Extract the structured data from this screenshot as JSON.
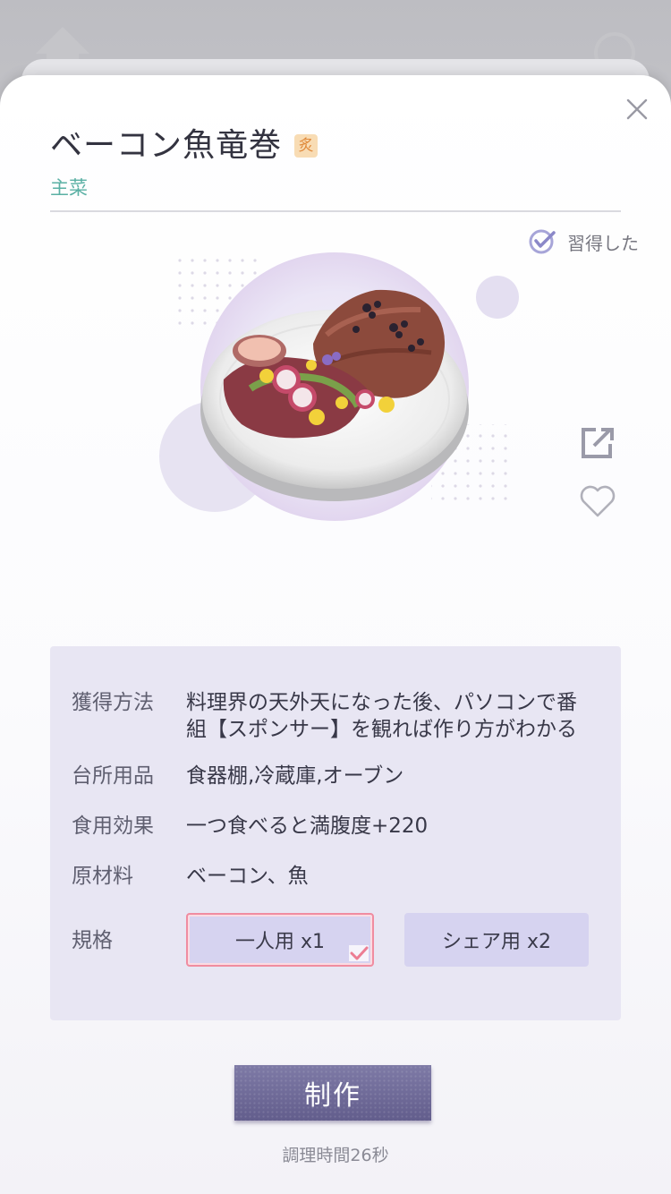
{
  "dish": {
    "name": "ベーコン魚竜巻",
    "badge": "炙",
    "category": "主菜",
    "learned_label": "習得した"
  },
  "info": {
    "rows": [
      {
        "label": "獲得方法",
        "value_line1": "料理界の天外天になった後、パソコンで番",
        "value_line2": "組【スポンサー】を観れば作り方がわかる"
      },
      {
        "label": "台所用品",
        "value": "食器棚,冷蔵庫,オーブン"
      },
      {
        "label": "食用効果",
        "value": "一つ食べると満腹度+220"
      },
      {
        "label": "原材料",
        "value": "ベーコン、魚"
      },
      {
        "label": "規格"
      }
    ],
    "spec_options": [
      "一人用 x1",
      "シェア用 x2"
    ],
    "selected_spec": "一人用 x1"
  },
  "actions": {
    "make_label": "制作",
    "cook_time": "調理時間26秒"
  },
  "colors": {
    "accent_teal": "#5ab0a4",
    "make_button": "#6f6a98",
    "selected_border": "#f08ca0",
    "card_bg": "#e8e6f3"
  },
  "icons": [
    "close-icon",
    "check-circle-icon",
    "share-icon",
    "heart-icon",
    "checkmark-icon"
  ]
}
